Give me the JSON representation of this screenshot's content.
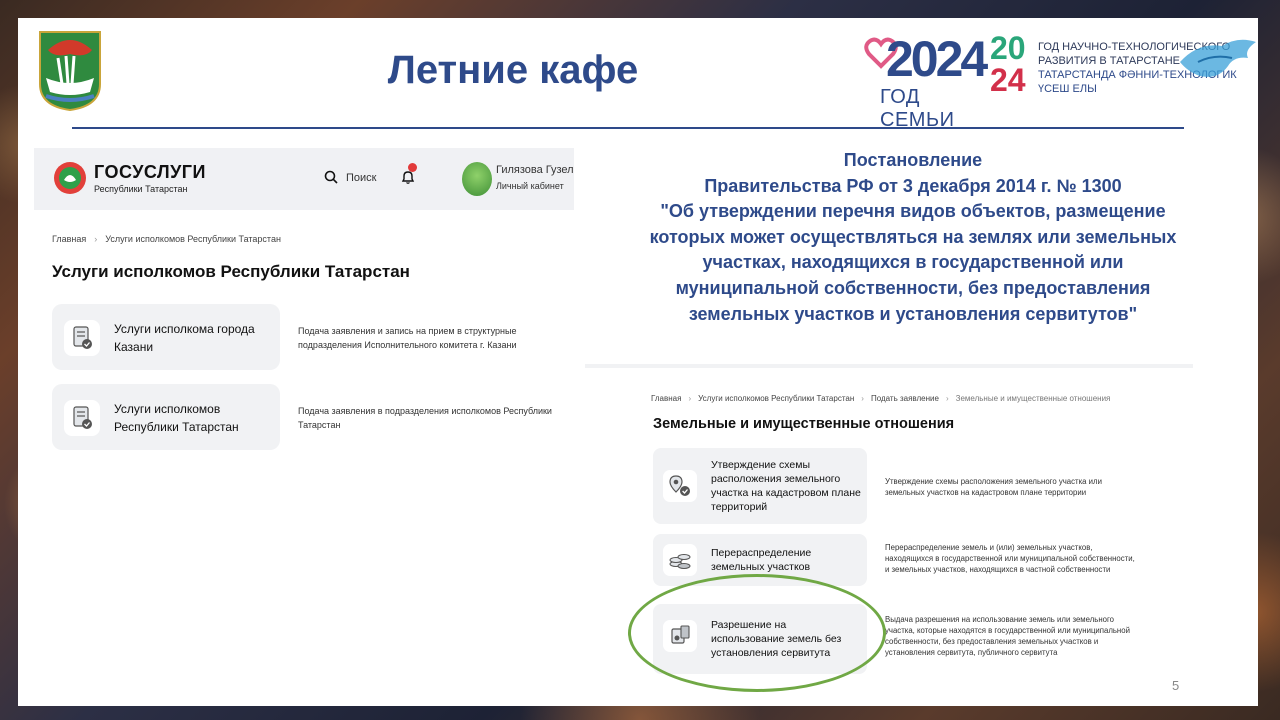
{
  "slide": {
    "title": "Летние кафе",
    "page_number": "5"
  },
  "logos": {
    "family_year": {
      "digits": "2024",
      "caption": "ГОД СЕМЬИ",
      "heart_color": "#e05a86"
    },
    "science_year": {
      "year_top": "20",
      "year_bottom": "24",
      "line1": "ГОД НАУЧНО-ТЕХНОЛОГИЧЕСКОГО",
      "line2": "РАЗВИТИЯ В ТАТАРСТАНЕ",
      "line3": "ТАТАРСТАНДА ФӘННИ-ТЕХНОЛОГИК",
      "line4": "ҮСЕШ ЕЛЫ"
    }
  },
  "gosuslugi": {
    "name": "ГОСУСЛУГИ",
    "region": "Республики Татарстан",
    "search_label": "Поиск",
    "user_name": "Гилязова Гузель",
    "user_cabinet": "Личный кабинет",
    "breadcrumb": [
      "Главная",
      "Услуги исполкомов Республики Татарстан"
    ],
    "page_title": "Услуги исполкомов Республики Татарстан",
    "services": [
      {
        "title": "Услуги исполкома города Казани",
        "description": "Подача заявления и запись на прием в структурные подразделения Исполнительного комитета г. Казани"
      },
      {
        "title": "Услуги исполкомов Республики Татарстан",
        "description": "Подача заявления в подразделения исполкомов Республики Татарстан"
      }
    ]
  },
  "decree": {
    "line1": "Постановление",
    "line2": "Правительства  РФ от 3 декабря 2014 г. № 1300",
    "line3": "\"Об утверждении перечня видов объектов, размещение",
    "line4": "которых может осуществляться  на землях или земельных",
    "line5": "участках, находящихся в государственной или",
    "line6": "муниципальной собственности, без предоставления",
    "line7": "земельных участков и установления сервитутов\""
  },
  "land": {
    "breadcrumb": [
      "Главная",
      "Услуги исполкомов Республики Татарстан",
      "Подать заявление",
      "Земельные и имущественные отношения"
    ],
    "page_title": "Земельные и имущественные отношения",
    "services": [
      {
        "title": "Утверждение схемы расположения земельного участка на кадастровом плане территорий",
        "description": "Утверждение схемы расположения земельного участка или земельных участков на кадастровом плане территории"
      },
      {
        "title": "Перераспределение земельных участков",
        "description": "Перераспределение земель и (или) земельных участков, находящихся в государственной или муниципальной собственности, и земельных участков, находящихся в частной собственности"
      },
      {
        "title": "Разрешение на использование земель без установления сервитута",
        "description": "Выдача разрешения на использование земель или земельного участка, которые находятся в государственной или муниципальной собственности, без предоставления земельных участков и установления сервитута, публичного сервитута"
      }
    ]
  },
  "colors": {
    "title_blue": "#2e4a8a",
    "highlight_green": "#70a845",
    "gos_red": "#e2403a"
  }
}
